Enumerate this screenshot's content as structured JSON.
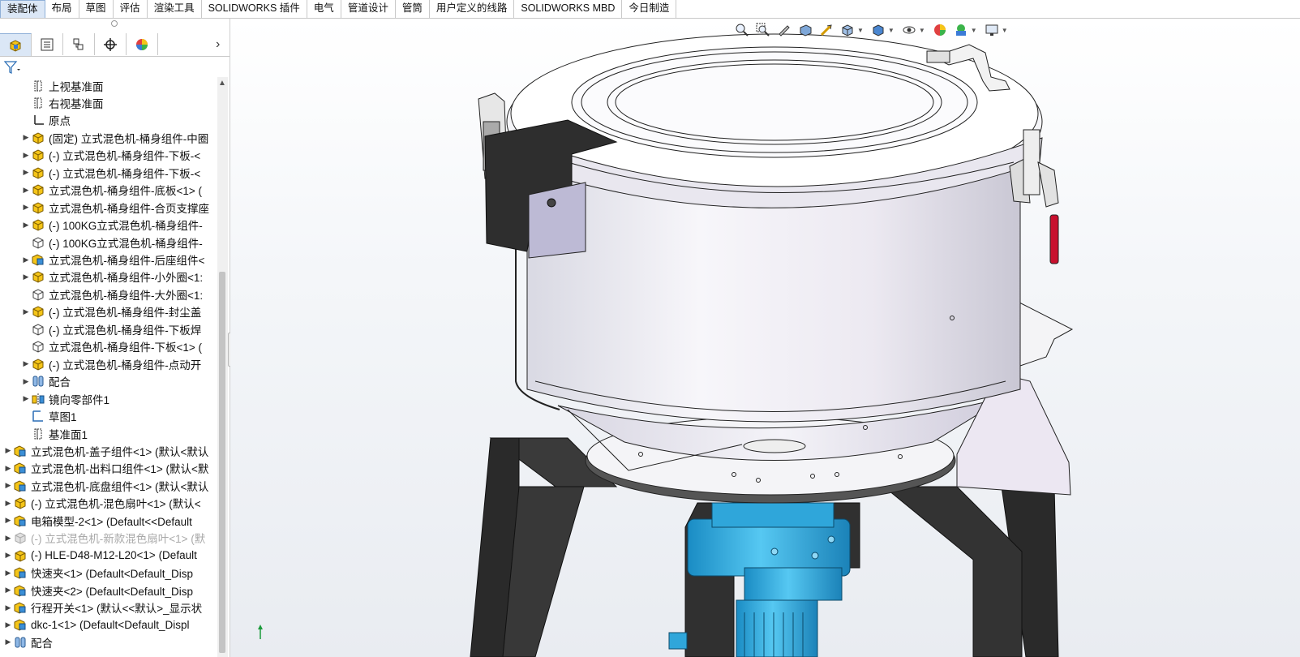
{
  "tabs": [
    {
      "label": "装配体",
      "active": true
    },
    {
      "label": "布局"
    },
    {
      "label": "草图"
    },
    {
      "label": "评估"
    },
    {
      "label": "渲染工具"
    },
    {
      "label": "SOLIDWORKS 插件"
    },
    {
      "label": "电气"
    },
    {
      "label": "管道设计"
    },
    {
      "label": "管筒"
    },
    {
      "label": "用户定义的线路"
    },
    {
      "label": "SOLIDWORKS MBD"
    },
    {
      "label": "今日制造"
    }
  ],
  "panel_tabs": [
    "feature-manager-icon",
    "property-manager-icon",
    "configuration-manager-icon",
    "dimxpert-icon",
    "display-manager-icon"
  ],
  "tree": [
    {
      "label": "上视基准面",
      "icon": "plane-icon"
    },
    {
      "label": "右视基准面",
      "icon": "plane-icon"
    },
    {
      "label": "原点",
      "icon": "origin-icon"
    },
    {
      "label": "(固定) 立式混色机-桶身组件-中圈",
      "icon": "part-icon"
    },
    {
      "label": "(-) 立式混色机-桶身组件-下板-<",
      "icon": "part-icon"
    },
    {
      "label": "(-) 立式混色机-桶身组件-下板-<",
      "icon": "part-icon"
    },
    {
      "label": "立式混色机-桶身组件-底板<1> (",
      "icon": "part-icon"
    },
    {
      "label": "立式混色机-桶身组件-合页支撑座",
      "icon": "part-icon"
    },
    {
      "label": "(-) 100KG立式混色机-桶身组件-",
      "icon": "part-icon"
    },
    {
      "label": "(-) 100KG立式混色机-桶身组件-",
      "icon": "part-outline-icon"
    },
    {
      "label": "立式混色机-桶身组件-后座组件<",
      "icon": "assembly-icon"
    },
    {
      "label": "立式混色机-桶身组件-小外圈<1:",
      "icon": "part-icon"
    },
    {
      "label": "立式混色机-桶身组件-大外圈<1:",
      "icon": "part-outline-icon"
    },
    {
      "label": "(-) 立式混色机-桶身组件-封尘盖",
      "icon": "part-icon"
    },
    {
      "label": "(-) 立式混色机-桶身组件-下板焊",
      "icon": "part-outline-icon"
    },
    {
      "label": "立式混色机-桶身组件-下板<1> (",
      "icon": "part-outline-icon"
    },
    {
      "label": "(-) 立式混色机-桶身组件-点动开",
      "icon": "part-icon"
    },
    {
      "label": "配合",
      "icon": "mates-icon"
    },
    {
      "label": "镜向零部件1",
      "icon": "mirror-component-icon"
    },
    {
      "label": "草图1",
      "icon": "sketch-icon"
    },
    {
      "label": "基准面1",
      "icon": "plane-icon"
    },
    {
      "label": "立式混色机-盖子组件<1> (默认<默认",
      "icon": "assembly-icon"
    },
    {
      "label": "立式混色机-出料口组件<1> (默认<默",
      "icon": "assembly-icon"
    },
    {
      "label": "立式混色机-底盘组件<1> (默认<默认",
      "icon": "assembly-icon"
    },
    {
      "label": "(-) 立式混色机-混色扇叶<1> (默认<",
      "icon": "part-icon"
    },
    {
      "label": "电箱模型-2<1> (Default<<Default",
      "icon": "assembly-icon"
    },
    {
      "label": "(-) 立式混色机-新款混色扇叶<1> (默",
      "icon": "suppressed-part-icon"
    },
    {
      "label": "(-) HLE-D48-M12-L20<1> (Default",
      "icon": "part-icon"
    },
    {
      "label": "快速夹<1> (Default<Default_Disp",
      "icon": "assembly-icon"
    },
    {
      "label": "快速夹<2> (Default<Default_Disp",
      "icon": "assembly-icon"
    },
    {
      "label": "行程开关<1> (默认<<默认>_显示状",
      "icon": "assembly-icon"
    },
    {
      "label": "dkc-1<1> (Default<Default_Displ",
      "icon": "assembly-icon"
    },
    {
      "label": "配合",
      "icon": "mates-icon"
    }
  ],
  "heads_up_icons": [
    "zoom-to-fit-icon",
    "zoom-to-area-icon",
    "previous-view-icon",
    "section-view-icon",
    "dynamic-annotation-icon",
    "view-orientation-icon",
    "display-style-icon",
    "hide-show-icon",
    "edit-appearance-icon",
    "apply-scene-icon",
    "view-settings-icon"
  ],
  "colors": {
    "accent": "#dbe7f6",
    "motor_blue": "#3bb4e6",
    "leg_dark": "#2d2d2d",
    "body_shell": "#ececf2",
    "handle_red": "#c8102e"
  }
}
